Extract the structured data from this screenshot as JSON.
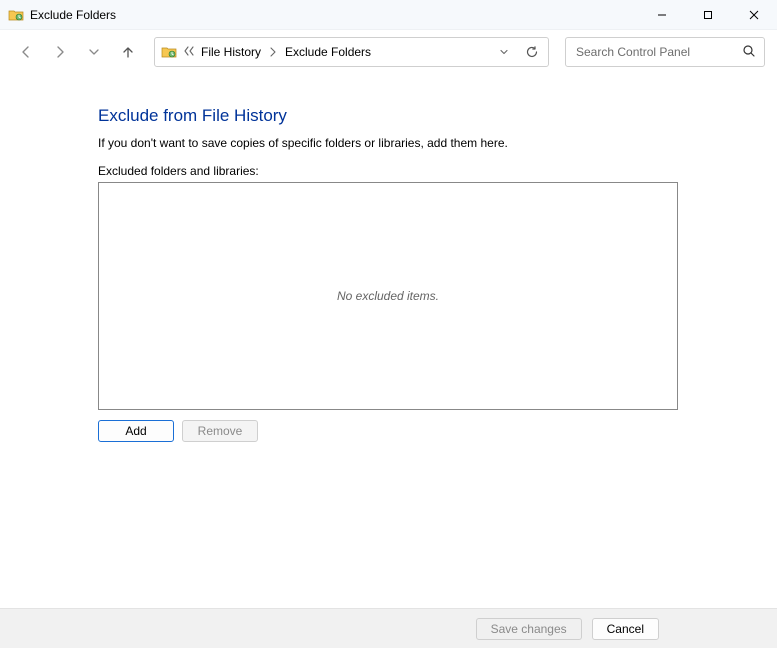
{
  "window": {
    "title": "Exclude Folders"
  },
  "address": {
    "crumb1": "File History",
    "crumb2": "Exclude Folders"
  },
  "search": {
    "placeholder": "Search Control Panel"
  },
  "page": {
    "heading": "Exclude from File History",
    "sub": "If you don't want to save copies of specific folders or libraries, add them here.",
    "list_label": "Excluded folders and libraries:",
    "empty": "No excluded items.",
    "add": "Add",
    "remove": "Remove"
  },
  "footer": {
    "save": "Save changes",
    "cancel": "Cancel"
  }
}
